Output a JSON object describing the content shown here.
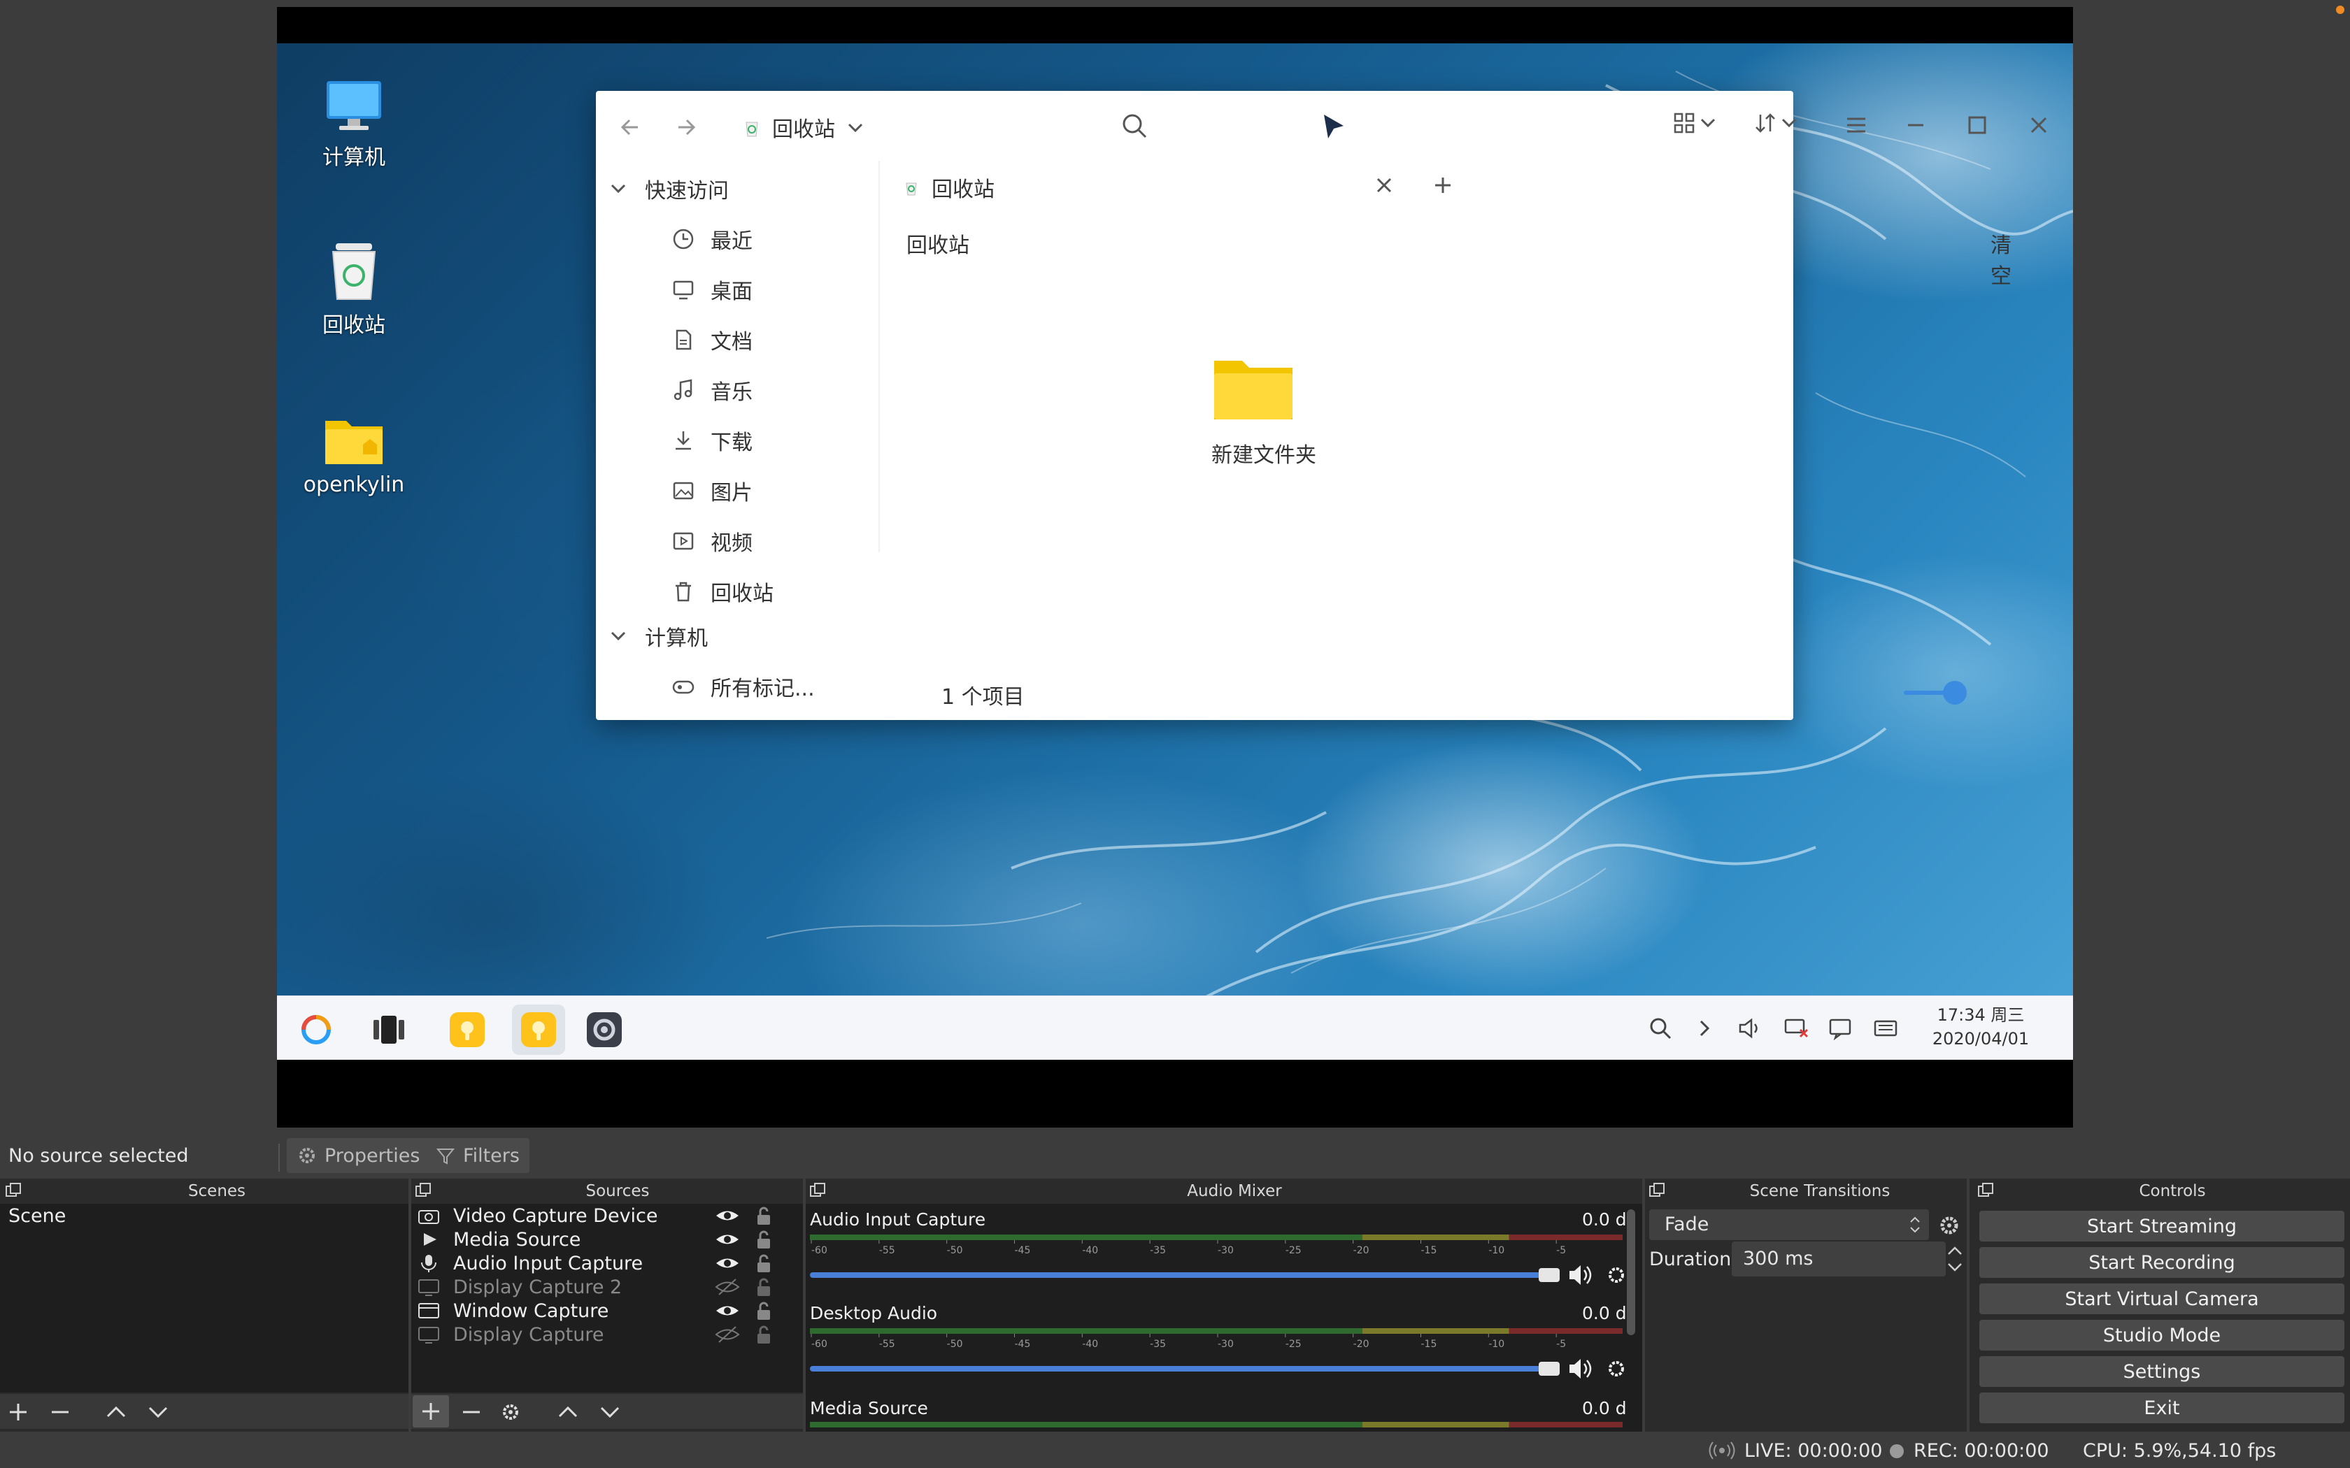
{
  "desktop": {
    "icons": [
      {
        "label": "计算机",
        "icon": "computer-icon"
      },
      {
        "label": "回收站",
        "icon": "trash-icon"
      },
      {
        "label": "openkylin",
        "icon": "home-folder-icon"
      }
    ]
  },
  "file_manager": {
    "location": "回收站",
    "sidebar": {
      "quick_access": "快速访问",
      "items": [
        {
          "label": "最近",
          "icon": "clock-icon"
        },
        {
          "label": "桌面",
          "icon": "monitor-icon"
        },
        {
          "label": "文档",
          "icon": "document-icon"
        },
        {
          "label": "音乐",
          "icon": "music-icon"
        },
        {
          "label": "下载",
          "icon": "download-icon"
        },
        {
          "label": "图片",
          "icon": "picture-icon"
        },
        {
          "label": "视频",
          "icon": "video-icon"
        },
        {
          "label": "回收站",
          "icon": "trash-icon"
        }
      ],
      "computer": "计算机",
      "tags": "所有标记..."
    },
    "tab_label": "回收站",
    "path_label": "回收站",
    "empty_button": "清空",
    "folder_name": "新建文件夹",
    "item_count": "1 个项目"
  },
  "taskbar": {
    "time": "17:34 周三",
    "date": "2020/04/01"
  },
  "obs": {
    "no_source": "No source selected",
    "properties": "Properties",
    "filters": "Filters",
    "docks": {
      "scenes": "Scenes",
      "sources": "Sources",
      "audio_mixer": "Audio Mixer",
      "scene_transitions": "Scene Transitions",
      "controls": "Controls"
    },
    "scenes": [
      "Scene"
    ],
    "sources": [
      {
        "name": "Video Capture Device",
        "icon": "camera-icon",
        "visible": true
      },
      {
        "name": "Media Source",
        "icon": "play-icon",
        "visible": true
      },
      {
        "name": "Audio Input Capture",
        "icon": "microphone-icon",
        "visible": true
      },
      {
        "name": "Display Capture 2",
        "icon": "display-icon",
        "visible": false
      },
      {
        "name": "Window Capture",
        "icon": "window-icon",
        "visible": true
      },
      {
        "name": "Display Capture",
        "icon": "display-icon",
        "visible": false
      }
    ],
    "mixer": [
      {
        "name": "Audio Input Capture",
        "value": "0.0 d"
      },
      {
        "name": "Desktop Audio",
        "value": "0.0 d"
      },
      {
        "name": "Media Source",
        "value": "0.0 d"
      }
    ],
    "meter_ticks": [
      "-60",
      "-55",
      "-50",
      "-45",
      "-40",
      "-35",
      "-30",
      "-25",
      "-20",
      "-15",
      "-10",
      "-5"
    ],
    "transition": "Fade",
    "duration_label": "Duration",
    "duration_value": "300 ms",
    "controls": [
      "Start Streaming",
      "Start Recording",
      "Start Virtual Camera",
      "Studio Mode",
      "Settings",
      "Exit"
    ],
    "status": {
      "live": "LIVE: 00:00:00",
      "rec": "REC: 00:00:00",
      "cpu": "CPU: 5.9%,54.10 fps"
    }
  }
}
